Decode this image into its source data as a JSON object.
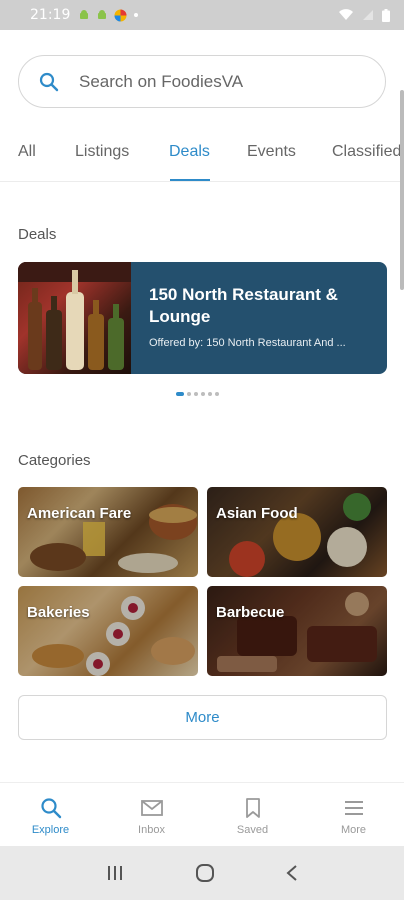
{
  "status_bar": {
    "time": "21:19"
  },
  "search": {
    "placeholder": "Search on FoodiesVA"
  },
  "tabs": [
    {
      "label": "All"
    },
    {
      "label": "Listings"
    },
    {
      "label": "Deals"
    },
    {
      "label": "Events"
    },
    {
      "label": "Classified"
    }
  ],
  "deals": {
    "section_title": "Deals",
    "card": {
      "title": "150 North Restaurant & Lounge",
      "offered_by": "Offered by: 150 North Restaurant And ..."
    }
  },
  "categories": {
    "section_title": "Categories",
    "items": [
      {
        "label": "American Fare"
      },
      {
        "label": "Asian Food"
      },
      {
        "label": "Bakeries"
      },
      {
        "label": "Barbecue"
      }
    ]
  },
  "more_button": {
    "label": "More"
  },
  "bottom_nav": [
    {
      "label": "Explore"
    },
    {
      "label": "Inbox"
    },
    {
      "label": "Saved"
    },
    {
      "label": "More"
    }
  ],
  "colors": {
    "accent": "#2e8bc9",
    "deal_card": "#24506e"
  }
}
